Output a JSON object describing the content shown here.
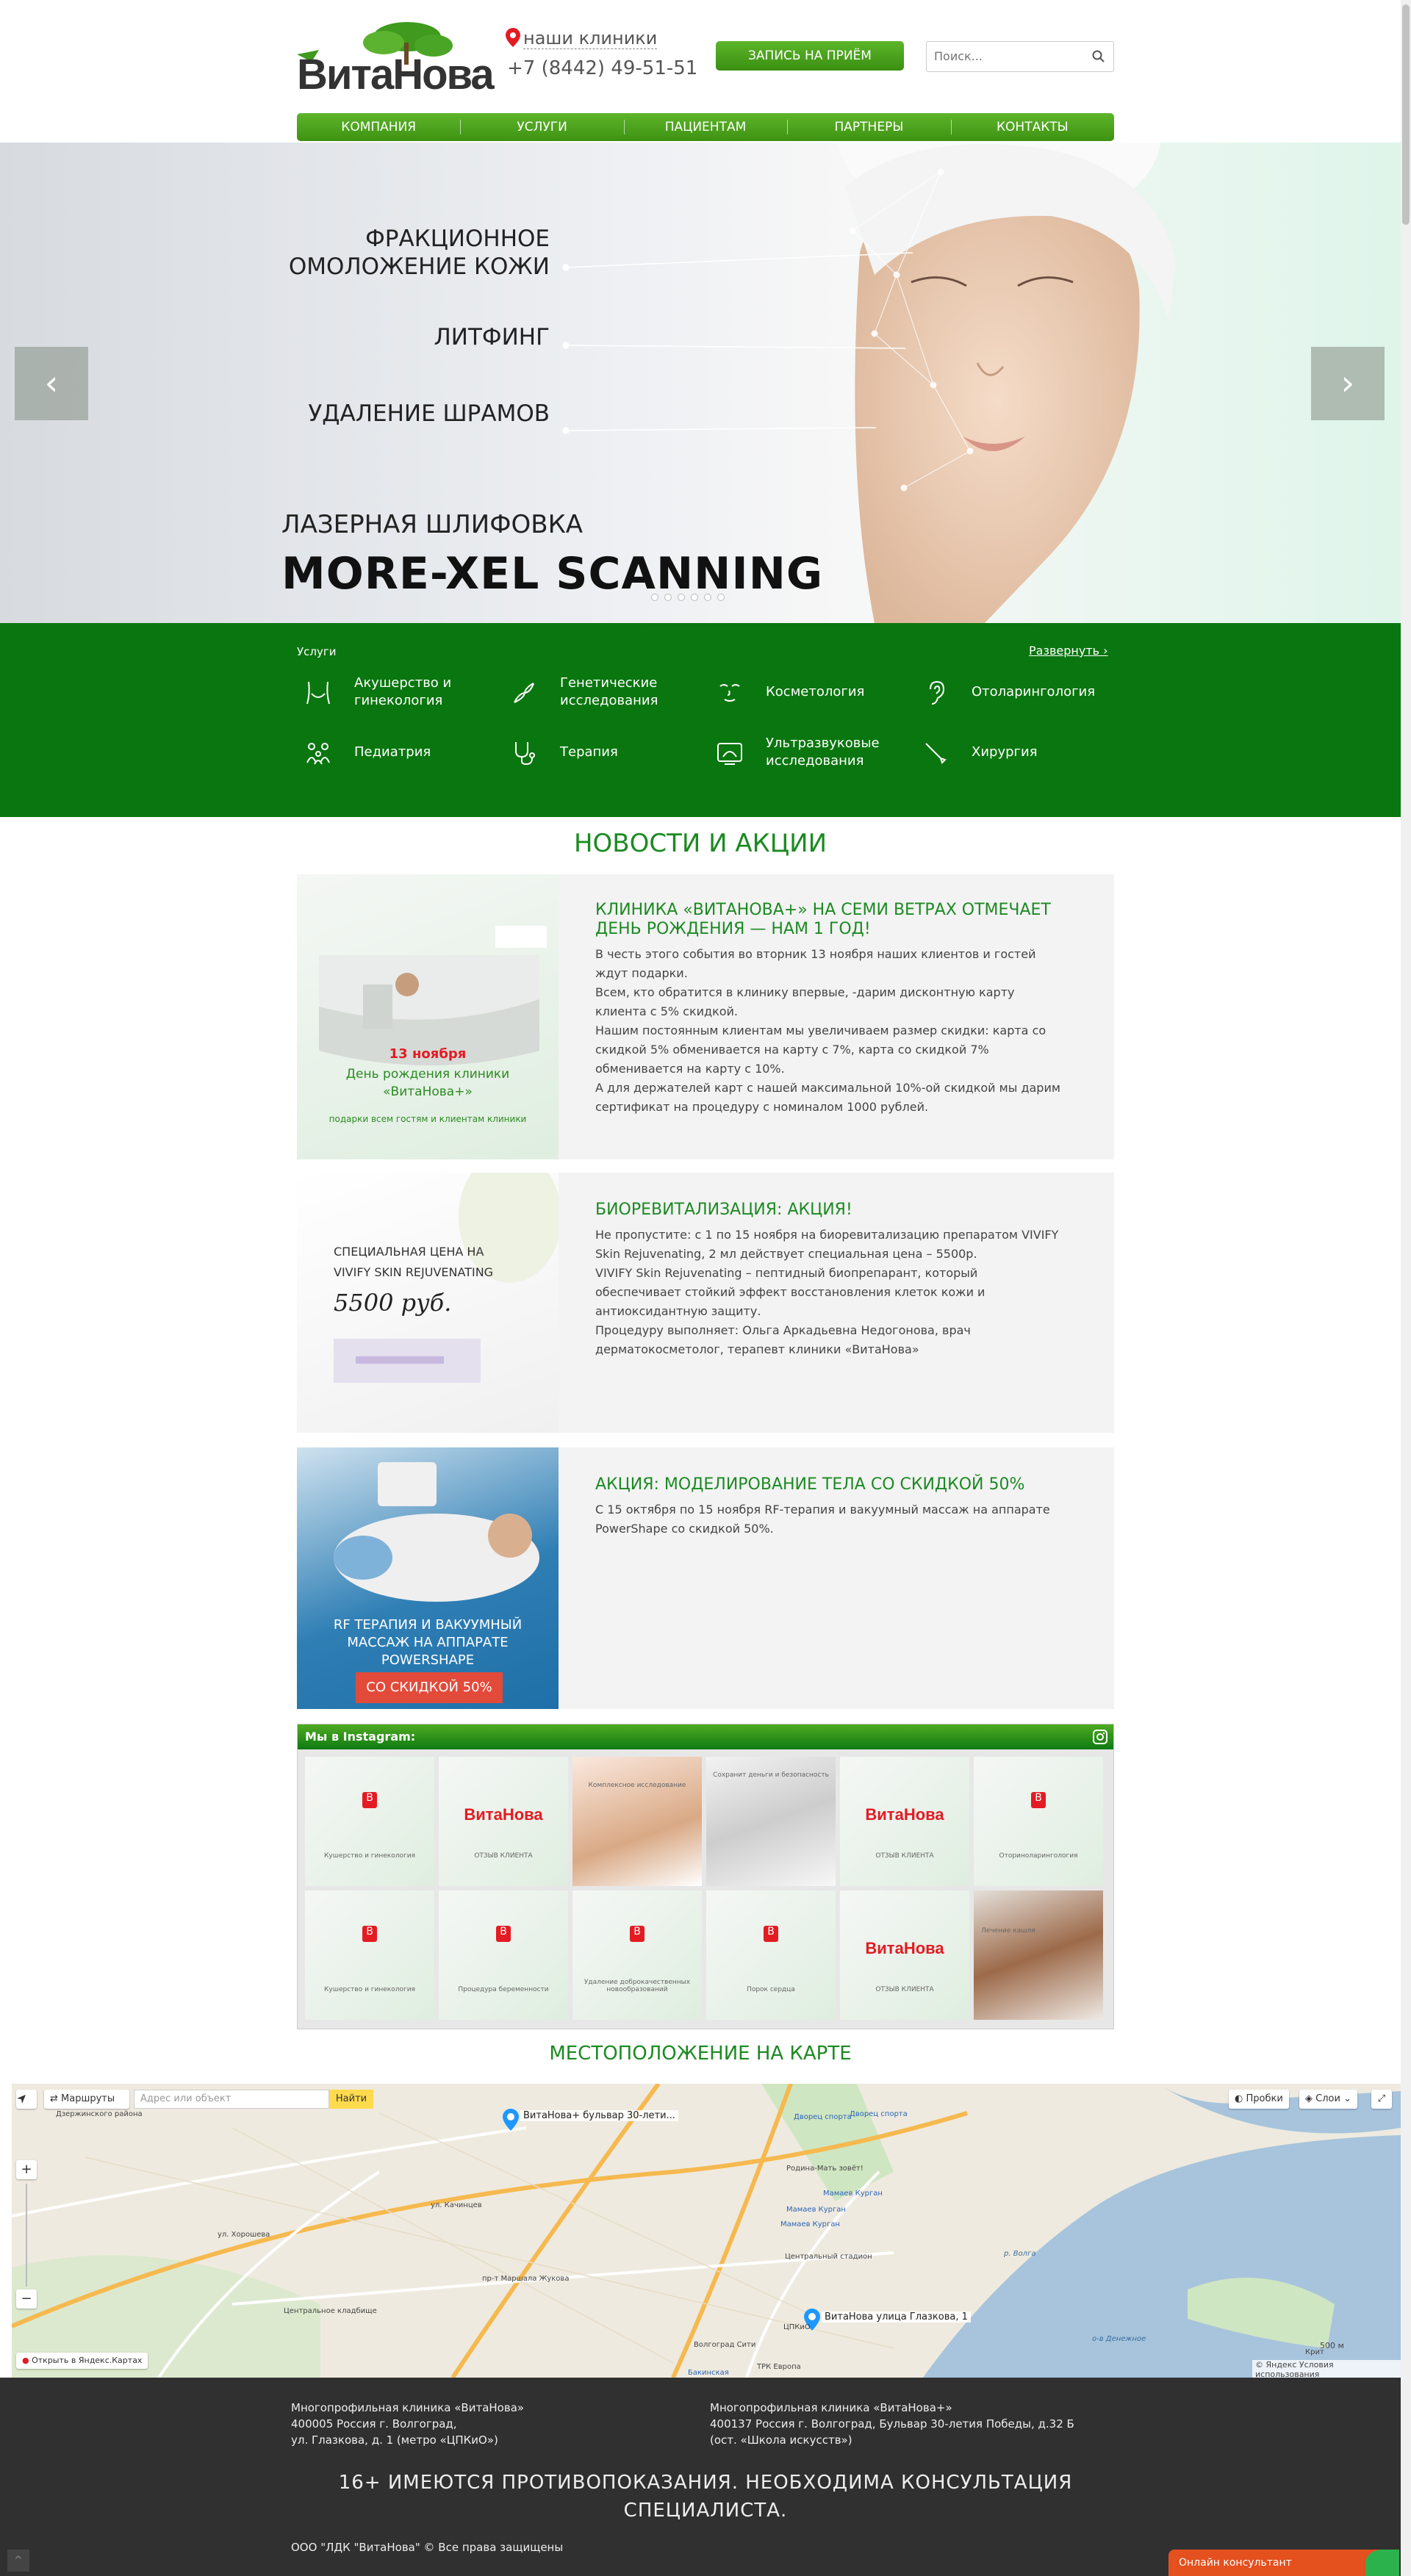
{
  "header": {
    "logo_text": "ВитаНова",
    "clinics_label": "наши клиники",
    "phone": "+7 (8442) 49-51-51",
    "appointment_button": "ЗАПИСЬ НА ПРИЁМ",
    "search_placeholder": "Поиск..."
  },
  "nav": [
    "КОМПАНИЯ",
    "УСЛУГИ",
    "ПАЦИЕНТАМ",
    "ПАРТНЕРЫ",
    "КОНТАКТЫ"
  ],
  "slider": {
    "lines": [
      "ФРАКЦИОННОЕ\nОМОЛОЖЕНИЕ КОЖИ",
      "ЛИТФИНГ",
      "УДАЛЕНИЕ ШРАМОВ"
    ],
    "subtitle": "ЛАЗЕРНАЯ ШЛИФОВКА",
    "headline": "MORE-XEL SCANNING",
    "prev_arrow": "‹",
    "next_arrow": "›",
    "dots_total": 6,
    "active_dot": 4
  },
  "services": {
    "title": "Услуги",
    "expand": "Развернуть ›",
    "items": [
      {
        "label": "Акушерство и\nгинекология",
        "icon": "pelvis-icon"
      },
      {
        "label": "Генетические\nисследования",
        "icon": "dna-icon"
      },
      {
        "label": "Косметология",
        "icon": "face-icon"
      },
      {
        "label": "Отоларингология",
        "icon": "ear-icon"
      },
      {
        "label": "Педиатрия",
        "icon": "family-icon"
      },
      {
        "label": "Терапия",
        "icon": "stethoscope-icon"
      },
      {
        "label": "Ультразвуковые\nисследования",
        "icon": "ultrasound-icon"
      },
      {
        "label": "Хирургия",
        "icon": "scalpel-icon"
      }
    ]
  },
  "news": {
    "title": "НОВОСТИ И АКЦИИ",
    "items": [
      {
        "title": "КЛИНИКА «ВИТАНОВА+» НА СЕМИ ВЕТРАХ ОТМЕЧАЕТ ДЕНЬ РОЖДЕНИЯ — НАМ 1 ГОД!",
        "text": "В честь этого события во вторник 13 ноября наших клиентов и гостей ждут подарки.\nВсем, кто обратится в клинику впервые, -дарим дисконтную карту клиента с 5% скидкой.\nНашим постоянным клиентам мы увеличиваем размер скидки: карта со скидкой 5% обменивается на карту с 7%, карта со скидкой 7% обменивается на карту с 10%.\nА для держателей карт с нашей максимальной 10%-ой скидкой мы дарим сертификат на процедуру с номиналом 1000 рублей.",
        "image_date": "13 ноября",
        "image_caption": "День рождения клиники «ВитаНова+»",
        "image_footer": "подарки всем гостям и клиентам клиники"
      },
      {
        "title": "БИОРЕВИТАЛИЗАЦИЯ: АКЦИЯ!",
        "text": "Не пропустите: с 1 по 15 ноября на биоревитализацию препаратом VIVIFY Skin Rejuvenating, 2 мл действует специальная цена – 5500р.\nVIVIFY Skin Rejuvenating – пептидный биопрепарант, который обеспечивает стойкий эффект восстановления клеток кожи и антиоксидантную защиту.\nПроцедуру выполняет: Ольга Аркадьевна Недогонова, врач дерматокосметолог, терапевт клиники «ВитаНова»",
        "image_caption": "СПЕЦИАЛЬНАЯ ЦЕНА НА VIVIFY SKIN REJUVENATING",
        "image_price": "5500 руб."
      },
      {
        "title": "АКЦИЯ: МОДЕЛИРОВАНИЕ ТЕЛА СО СКИДКОЙ 50%",
        "text": "С 15 октября по 15 ноября RF-терапия и вакуумный массаж на аппарате PowerShape со скидкой 50%.",
        "image_caption": "RF ТЕРАПИЯ И ВАКУУМНЫЙ МАССАЖ НА АППАРАТЕ POWERSHAPE",
        "image_badge": "СО СКИДКОЙ 50%"
      }
    ]
  },
  "instagram": {
    "title": "Мы в Instagram:",
    "tiles": [
      {
        "kind": "b",
        "caption": "Кушерство и гинекология"
      },
      {
        "kind": "logo",
        "caption": "ОТЗЫВ КЛИЕНТА"
      },
      {
        "kind": "photo",
        "caption": "Комплексное исследование"
      },
      {
        "kind": "photo2",
        "caption": "Сохранит деньги и безопасность"
      },
      {
        "kind": "logo",
        "caption": "ОТЗЫВ КЛИЕНТА"
      },
      {
        "kind": "b",
        "caption": "Оториноларингология"
      },
      {
        "kind": "b",
        "caption": "Кушерство и гинекология"
      },
      {
        "kind": "b",
        "caption": "Процедура беременности"
      },
      {
        "kind": "b",
        "caption": "Удаление доброкачественных новообразований"
      },
      {
        "kind": "b",
        "caption": "Порок сердца"
      },
      {
        "kind": "logo",
        "caption": "ОТЗЫВ КЛИЕНТА"
      },
      {
        "kind": "photo3",
        "caption": "Лечение кашля"
      }
    ]
  },
  "map": {
    "title": "МЕСТОПОЛОЖЕНИЕ НА КАРТЕ",
    "routes_button": "Маршруты",
    "address_placeholder": "Адрес или объект",
    "find_button": "Найти",
    "traffic_button": "Пробки",
    "layers_button": "Слои",
    "zoom_in": "+",
    "zoom_out": "−",
    "marker1": "ВитаНова+ бульвар 30-лети...",
    "marker2": "ВитаНова улица Глазкова, 1",
    "open_yandex": "Открыть в Яндекс.Картах",
    "scale": "500 м",
    "copyright": "© Яндекс Условия использования",
    "place_labels": [
      "Дворец спорта",
      "Дворец спорта",
      "Родина-Мать зовёт!",
      "Мамаев Курган",
      "Мамаев Курган",
      "Мамаев Курган",
      "Центральный стадион",
      "Центральное кладбище",
      "ЦПКиО",
      "ТРК Европа",
      "Волгоград Сити",
      "Бакинская",
      "р. Волга",
      "Дзержинского района",
      "ул. Качинцев",
      "пр-т Маршала Жукова",
      "ул. Хорошева",
      "Крит",
      "о-в Денежное"
    ]
  },
  "footer": {
    "address1": "Многопрофильная клиника «ВитаНова»\n400005 Россия г. Волгоград,\nул. Глазкова, д. 1 (метро «ЦПКиО»)",
    "address2": "Многопрофильная клиника «ВитаНова+»\n400137 Россия г. Волгоград, Бульвар 30-летия Победы, д.32 Б\n(ост. «Школа искусств»)",
    "warning": "16+ ИМЕЮТСЯ ПРОТИВОПОКАЗАНИЯ. НЕОБХОДИМА КОНСУЛЬТАЦИЯ СПЕЦИАЛИСТА.",
    "copyright": "ООО \"ЛДК \"ВитаНова\" © Все права защищены",
    "chat": "Онлайн консультант",
    "to_top": "^"
  },
  "colors": {
    "brand_green": "#0a760f",
    "nav_green": "#4fab22",
    "title_green": "#1c8a22",
    "brand_red": "#e31b23",
    "footer": "#303030"
  }
}
